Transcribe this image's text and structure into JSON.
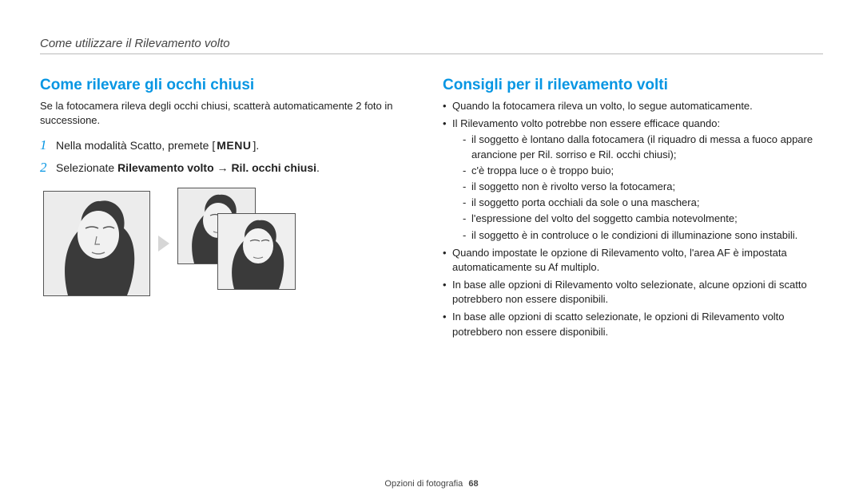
{
  "header": {
    "breadcrumb": "Come utilizzare il Rilevamento volto"
  },
  "left": {
    "heading": "Come rilevare gli occhi chiusi",
    "lead": "Se la fotocamera rileva degli occhi chiusi, scatterà automaticamente 2 foto in successione.",
    "step1_pre": "Nella modalità Scatto, premete [",
    "step1_menu": "MENU",
    "step1_post": "].",
    "step2_pre": "Selezionate ",
    "step2_bold1": "Rilevamento volto",
    "step2_arrow": " → ",
    "step2_bold2": "Ril. occhi chiusi",
    "step2_post": "."
  },
  "right": {
    "heading": "Consigli per il rilevamento volti",
    "b1": "Quando la fotocamera rileva un volto, lo segue automaticamente.",
    "b2_intro": "Il Rilevamento volto potrebbe non essere efficace quando:",
    "b2_items": [
      "il soggetto è lontano dalla fotocamera (il riquadro di messa a fuoco appare arancione per Ril. sorriso e Ril. occhi chiusi);",
      "c'è troppa luce o è troppo buio;",
      "il soggetto non è rivolto verso la fotocamera;",
      "il soggetto porta occhiali da sole o una maschera;",
      "l'espressione del volto del soggetto cambia notevolmente;",
      "il soggetto è in controluce o le condizioni di illuminazione sono instabili."
    ],
    "b3": "Quando impostate le opzione di Rilevamento volto, l'area AF è impostata automaticamente su Af multiplo.",
    "b4": "In base alle opzioni di Rilevamento volto selezionate, alcune opzioni di scatto potrebbero non essere disponibili.",
    "b5": "In base alle opzioni di scatto selezionate, le opzioni di Rilevamento volto potrebbero non essere disponibili."
  },
  "footer": {
    "section": "Opzioni di fotografia",
    "page": "68"
  },
  "icons": {
    "arrow_right": "arrow-right-icon",
    "portrait": "portrait-illustration"
  }
}
